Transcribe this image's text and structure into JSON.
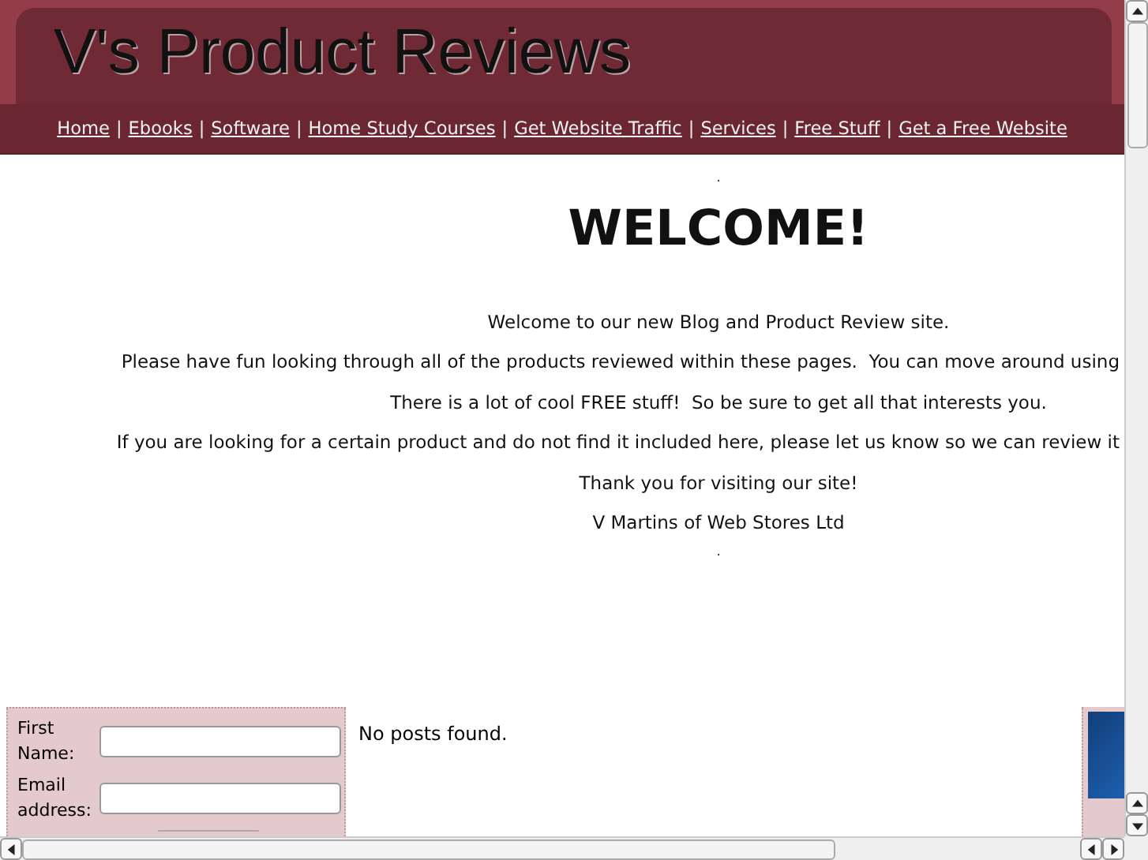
{
  "header": {
    "title": "V's Product Reviews"
  },
  "nav": [
    "Home",
    "Ebooks",
    "Software",
    "Home Study Courses",
    "Get Website Traffic",
    "Services",
    "Free Stuff",
    "Get a Free Website"
  ],
  "nav_separator": "|",
  "content": {
    "top_mark": ".",
    "heading": "WELCOME!",
    "lines": [
      {
        "text": "Welcome to our new Blog and Product Review site.",
        "cut": false
      },
      {
        "text": "Please have fun looking through all of the products reviewed within these pages.  You can move around using",
        "cut": true
      },
      {
        "text": "There is a lot of cool FREE stuff!  So be sure to get all that interests you.",
        "cut": false
      },
      {
        "text": "If you are looking for a certain product and do not find it included here, please let us know so we can review it",
        "cut": true
      },
      {
        "text": "Thank you for visiting our site!",
        "cut": false
      },
      {
        "text": "V Martins of Web Stores Ltd",
        "cut": false
      }
    ],
    "bottom_mark": "."
  },
  "signup": {
    "fields": [
      {
        "label": "First Name:"
      },
      {
        "label": "Email address:"
      }
    ]
  },
  "posts": {
    "message": "No posts found."
  }
}
